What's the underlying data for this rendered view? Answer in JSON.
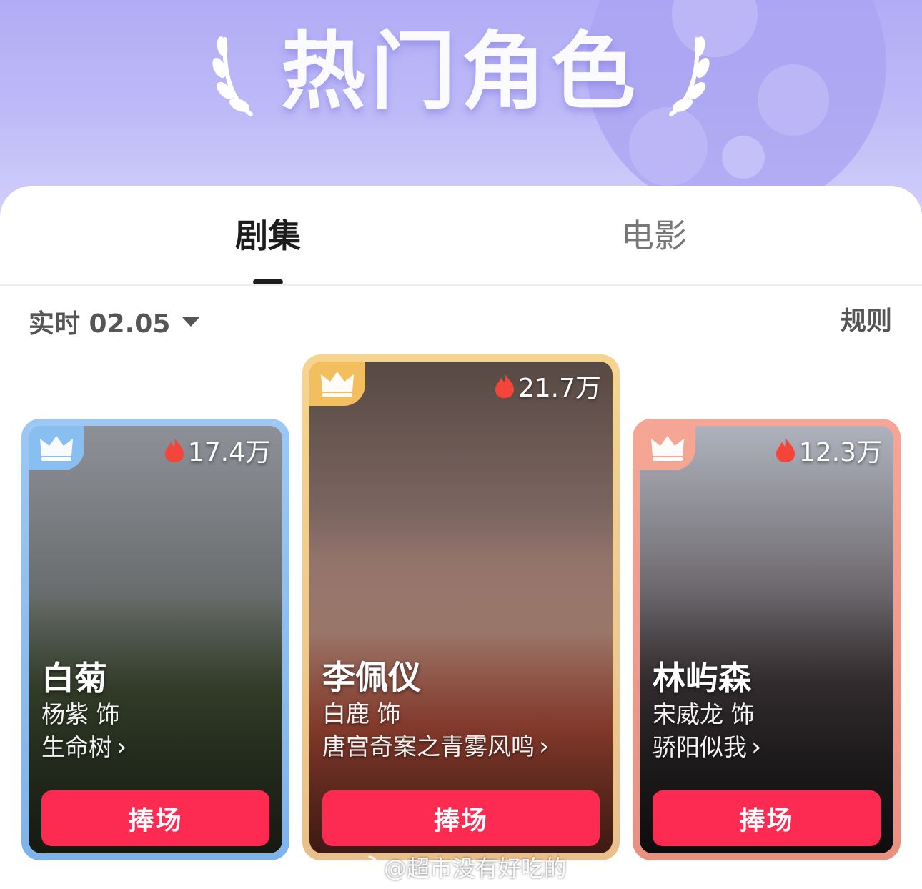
{
  "banner": {
    "title": "热门角色"
  },
  "tabs": [
    {
      "label": "剧集",
      "active": true
    },
    {
      "label": "电影",
      "active": false
    }
  ],
  "filter": {
    "date_label": "实时 02.05",
    "rules_label": "规则"
  },
  "cards": [
    {
      "rank": 1,
      "heat": "21.7万",
      "role": "李佩仪",
      "actor": "白鹿 饰",
      "show": "唐宫奇案之青雾风鸣",
      "button": "捧场"
    },
    {
      "rank": 2,
      "heat": "17.4万",
      "role": "白菊",
      "actor": "杨紫 饰",
      "show": "生命树",
      "button": "捧场"
    },
    {
      "rank": 3,
      "heat": "12.3万",
      "role": "林屿森",
      "actor": "宋威龙 饰",
      "show": "骄阳似我",
      "button": "捧场"
    }
  ],
  "watermark": {
    "text": "@超市没有好吃的"
  },
  "colors": {
    "accent_button": "#fd2b52",
    "banner_bg": "#b1acf6",
    "rank1_frame": "#f6d48e",
    "rank2_frame": "#9cc8f4",
    "rank3_frame": "#f6a596"
  },
  "icons": {
    "laurel": "laurel-icon",
    "crown": "crown-icon",
    "flame": "flame-icon",
    "caret": "caret-down-icon",
    "chevron": "chevron-right-icon"
  }
}
